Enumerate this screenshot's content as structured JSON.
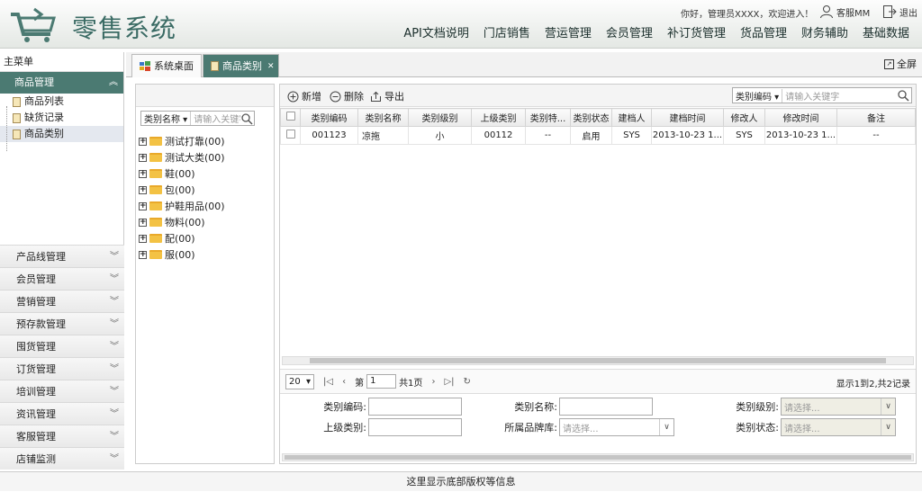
{
  "header": {
    "title": "零售系统",
    "welcome": "你好，管理员XXXX，欢迎进入！",
    "service": "客服MM",
    "logout": "退出",
    "nav": [
      "API文档说明",
      "门店销售",
      "营运管理",
      "会员管理",
      "补订货管理",
      "货品管理",
      "财务辅助",
      "基础数据"
    ]
  },
  "sidebar": {
    "title": "主菜单",
    "active_group": "商品管理",
    "items": [
      "商品列表",
      "缺货记录",
      "商品类别"
    ],
    "groups": [
      "产品线管理",
      "会员管理",
      "营销管理",
      "预存款管理",
      "囤货管理",
      "订货管理",
      "培训管理",
      "资讯管理",
      "客服管理",
      "店铺监测"
    ]
  },
  "tabs": [
    {
      "label": "系统桌面"
    },
    {
      "label": "商品类别"
    }
  ],
  "fullscreen": "全屏",
  "left": {
    "search_field": "类别名称",
    "search_placeholder": "请输入关键字",
    "categories": [
      "测试打靠(00)",
      "测试大类(00)",
      "鞋(00)",
      "包(00)",
      "护鞋用品(00)",
      "物料(00)",
      "配(00)",
      "服(00)"
    ]
  },
  "toolbar": {
    "add": "新增",
    "delete": "删除",
    "export": "导出",
    "search_field": "类别编码",
    "search_placeholder": "请输入关键字"
  },
  "table": {
    "headers": [
      "类别编码",
      "类别名称",
      "类别级别",
      "上级类别",
      "类别特...",
      "类别状态",
      "建档人",
      "建档时间",
      "修改人",
      "修改时间",
      "备注"
    ],
    "rows": [
      [
        "001123",
        "凉拖",
        "小",
        "00112",
        "--",
        "启用",
        "SYS",
        "2013-10-23 1...",
        "SYS",
        "2013-10-23 1...",
        "--"
      ]
    ]
  },
  "pager": {
    "size": "20",
    "page_prefix": "第",
    "page": "1",
    "page_suffix": "共1页",
    "info": "显示1到2,共2记录"
  },
  "form": {
    "code_label": "类别编码:",
    "name_label": "类别名称:",
    "level_label": "类别级别:",
    "parent_label": "上级类别:",
    "brand_label": "所属品牌库:",
    "status_label": "类别状态:",
    "placeholder": "请选择..."
  },
  "footer": "这里显示底部版权等信息"
}
